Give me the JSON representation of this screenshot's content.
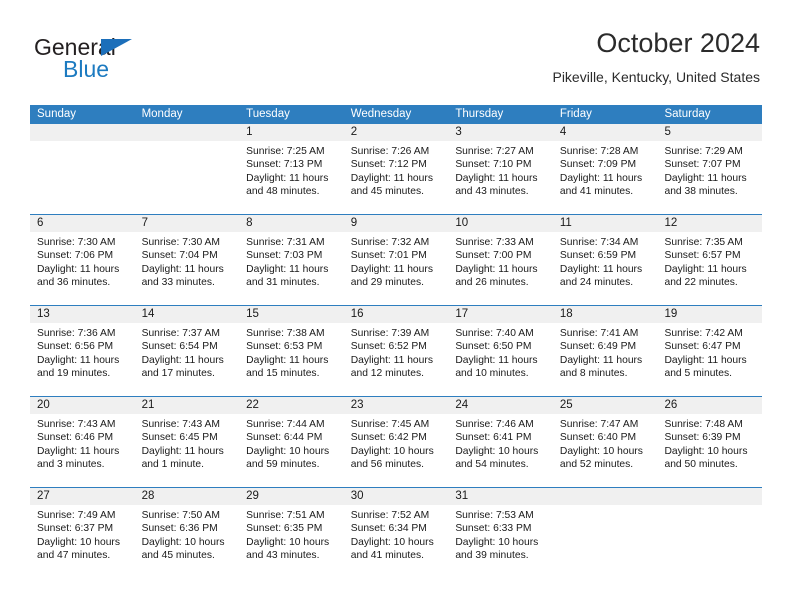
{
  "brand": {
    "name_part1": "General",
    "name_part2": "Blue",
    "triangle_color": "#1c6fba",
    "blue_color": "#1c7ac0"
  },
  "header": {
    "title": "October 2024",
    "subtitle": "Pikeville, Kentucky, United States"
  },
  "theme": {
    "header_blue": "#2e7ebf",
    "day_strip_gray": "#f0f0f0",
    "text_color": "#1a1a1a"
  },
  "weekdays": [
    "Sunday",
    "Monday",
    "Tuesday",
    "Wednesday",
    "Thursday",
    "Friday",
    "Saturday"
  ],
  "labels": {
    "sunrise": "Sunrise:",
    "sunset": "Sunset:",
    "daylight": "Daylight:"
  },
  "weeks": [
    [
      {
        "day": "",
        "sunrise": "",
        "sunset": "",
        "daylight": "",
        "empty": true
      },
      {
        "day": "",
        "sunrise": "",
        "sunset": "",
        "daylight": "",
        "empty": true
      },
      {
        "day": "1",
        "sunrise": "Sunrise: 7:25 AM",
        "sunset": "Sunset: 7:13 PM",
        "daylight": "Daylight: 11 hours and 48 minutes."
      },
      {
        "day": "2",
        "sunrise": "Sunrise: 7:26 AM",
        "sunset": "Sunset: 7:12 PM",
        "daylight": "Daylight: 11 hours and 45 minutes."
      },
      {
        "day": "3",
        "sunrise": "Sunrise: 7:27 AM",
        "sunset": "Sunset: 7:10 PM",
        "daylight": "Daylight: 11 hours and 43 minutes."
      },
      {
        "day": "4",
        "sunrise": "Sunrise: 7:28 AM",
        "sunset": "Sunset: 7:09 PM",
        "daylight": "Daylight: 11 hours and 41 minutes."
      },
      {
        "day": "5",
        "sunrise": "Sunrise: 7:29 AM",
        "sunset": "Sunset: 7:07 PM",
        "daylight": "Daylight: 11 hours and 38 minutes."
      }
    ],
    [
      {
        "day": "6",
        "sunrise": "Sunrise: 7:30 AM",
        "sunset": "Sunset: 7:06 PM",
        "daylight": "Daylight: 11 hours and 36 minutes."
      },
      {
        "day": "7",
        "sunrise": "Sunrise: 7:30 AM",
        "sunset": "Sunset: 7:04 PM",
        "daylight": "Daylight: 11 hours and 33 minutes."
      },
      {
        "day": "8",
        "sunrise": "Sunrise: 7:31 AM",
        "sunset": "Sunset: 7:03 PM",
        "daylight": "Daylight: 11 hours and 31 minutes."
      },
      {
        "day": "9",
        "sunrise": "Sunrise: 7:32 AM",
        "sunset": "Sunset: 7:01 PM",
        "daylight": "Daylight: 11 hours and 29 minutes."
      },
      {
        "day": "10",
        "sunrise": "Sunrise: 7:33 AM",
        "sunset": "Sunset: 7:00 PM",
        "daylight": "Daylight: 11 hours and 26 minutes."
      },
      {
        "day": "11",
        "sunrise": "Sunrise: 7:34 AM",
        "sunset": "Sunset: 6:59 PM",
        "daylight": "Daylight: 11 hours and 24 minutes."
      },
      {
        "day": "12",
        "sunrise": "Sunrise: 7:35 AM",
        "sunset": "Sunset: 6:57 PM",
        "daylight": "Daylight: 11 hours and 22 minutes."
      }
    ],
    [
      {
        "day": "13",
        "sunrise": "Sunrise: 7:36 AM",
        "sunset": "Sunset: 6:56 PM",
        "daylight": "Daylight: 11 hours and 19 minutes."
      },
      {
        "day": "14",
        "sunrise": "Sunrise: 7:37 AM",
        "sunset": "Sunset: 6:54 PM",
        "daylight": "Daylight: 11 hours and 17 minutes."
      },
      {
        "day": "15",
        "sunrise": "Sunrise: 7:38 AM",
        "sunset": "Sunset: 6:53 PM",
        "daylight": "Daylight: 11 hours and 15 minutes."
      },
      {
        "day": "16",
        "sunrise": "Sunrise: 7:39 AM",
        "sunset": "Sunset: 6:52 PM",
        "daylight": "Daylight: 11 hours and 12 minutes."
      },
      {
        "day": "17",
        "sunrise": "Sunrise: 7:40 AM",
        "sunset": "Sunset: 6:50 PM",
        "daylight": "Daylight: 11 hours and 10 minutes."
      },
      {
        "day": "18",
        "sunrise": "Sunrise: 7:41 AM",
        "sunset": "Sunset: 6:49 PM",
        "daylight": "Daylight: 11 hours and 8 minutes."
      },
      {
        "day": "19",
        "sunrise": "Sunrise: 7:42 AM",
        "sunset": "Sunset: 6:47 PM",
        "daylight": "Daylight: 11 hours and 5 minutes."
      }
    ],
    [
      {
        "day": "20",
        "sunrise": "Sunrise: 7:43 AM",
        "sunset": "Sunset: 6:46 PM",
        "daylight": "Daylight: 11 hours and 3 minutes."
      },
      {
        "day": "21",
        "sunrise": "Sunrise: 7:43 AM",
        "sunset": "Sunset: 6:45 PM",
        "daylight": "Daylight: 11 hours and 1 minute."
      },
      {
        "day": "22",
        "sunrise": "Sunrise: 7:44 AM",
        "sunset": "Sunset: 6:44 PM",
        "daylight": "Daylight: 10 hours and 59 minutes."
      },
      {
        "day": "23",
        "sunrise": "Sunrise: 7:45 AM",
        "sunset": "Sunset: 6:42 PM",
        "daylight": "Daylight: 10 hours and 56 minutes."
      },
      {
        "day": "24",
        "sunrise": "Sunrise: 7:46 AM",
        "sunset": "Sunset: 6:41 PM",
        "daylight": "Daylight: 10 hours and 54 minutes."
      },
      {
        "day": "25",
        "sunrise": "Sunrise: 7:47 AM",
        "sunset": "Sunset: 6:40 PM",
        "daylight": "Daylight: 10 hours and 52 minutes."
      },
      {
        "day": "26",
        "sunrise": "Sunrise: 7:48 AM",
        "sunset": "Sunset: 6:39 PM",
        "daylight": "Daylight: 10 hours and 50 minutes."
      }
    ],
    [
      {
        "day": "27",
        "sunrise": "Sunrise: 7:49 AM",
        "sunset": "Sunset: 6:37 PM",
        "daylight": "Daylight: 10 hours and 47 minutes."
      },
      {
        "day": "28",
        "sunrise": "Sunrise: 7:50 AM",
        "sunset": "Sunset: 6:36 PM",
        "daylight": "Daylight: 10 hours and 45 minutes."
      },
      {
        "day": "29",
        "sunrise": "Sunrise: 7:51 AM",
        "sunset": "Sunset: 6:35 PM",
        "daylight": "Daylight: 10 hours and 43 minutes."
      },
      {
        "day": "30",
        "sunrise": "Sunrise: 7:52 AM",
        "sunset": "Sunset: 6:34 PM",
        "daylight": "Daylight: 10 hours and 41 minutes."
      },
      {
        "day": "31",
        "sunrise": "Sunrise: 7:53 AM",
        "sunset": "Sunset: 6:33 PM",
        "daylight": "Daylight: 10 hours and 39 minutes."
      },
      {
        "day": "",
        "sunrise": "",
        "sunset": "",
        "daylight": "",
        "empty": true
      },
      {
        "day": "",
        "sunrise": "",
        "sunset": "",
        "daylight": "",
        "empty": true
      }
    ]
  ]
}
